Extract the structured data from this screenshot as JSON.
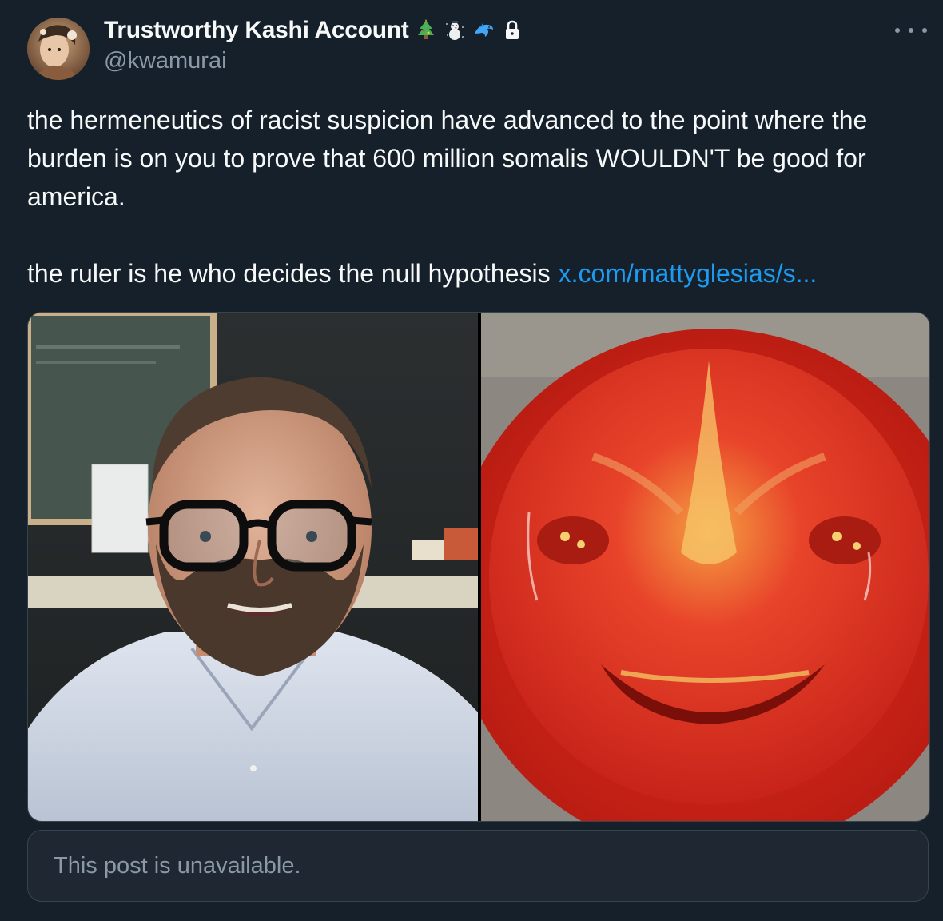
{
  "author": {
    "display_name": "Trustworthy Kashi Account",
    "handle": "@kwamurai",
    "badges": [
      "christmas-tree-icon",
      "snowman-icon",
      "dolphin-icon",
      "lock-icon"
    ]
  },
  "more_menu": {
    "icon": "more-horizontal-icon"
  },
  "post": {
    "paragraph_1": "the hermeneutics of racist suspicion have advanced to the point where the burden is on you to prove that 600 million somalis WOULDN'T be good for america.",
    "paragraph_2": "the ruler is he who decides the null hypothesis",
    "link_text": "x.com/mattyglesias/s..."
  },
  "quoted_post": {
    "status_text": "This post is unavailable."
  },
  "colors": {
    "background": "#15202b",
    "text_primary": "#f7f9f9",
    "text_secondary": "#8b98a5",
    "link": "#1d9bf0",
    "border": "#38444d"
  }
}
